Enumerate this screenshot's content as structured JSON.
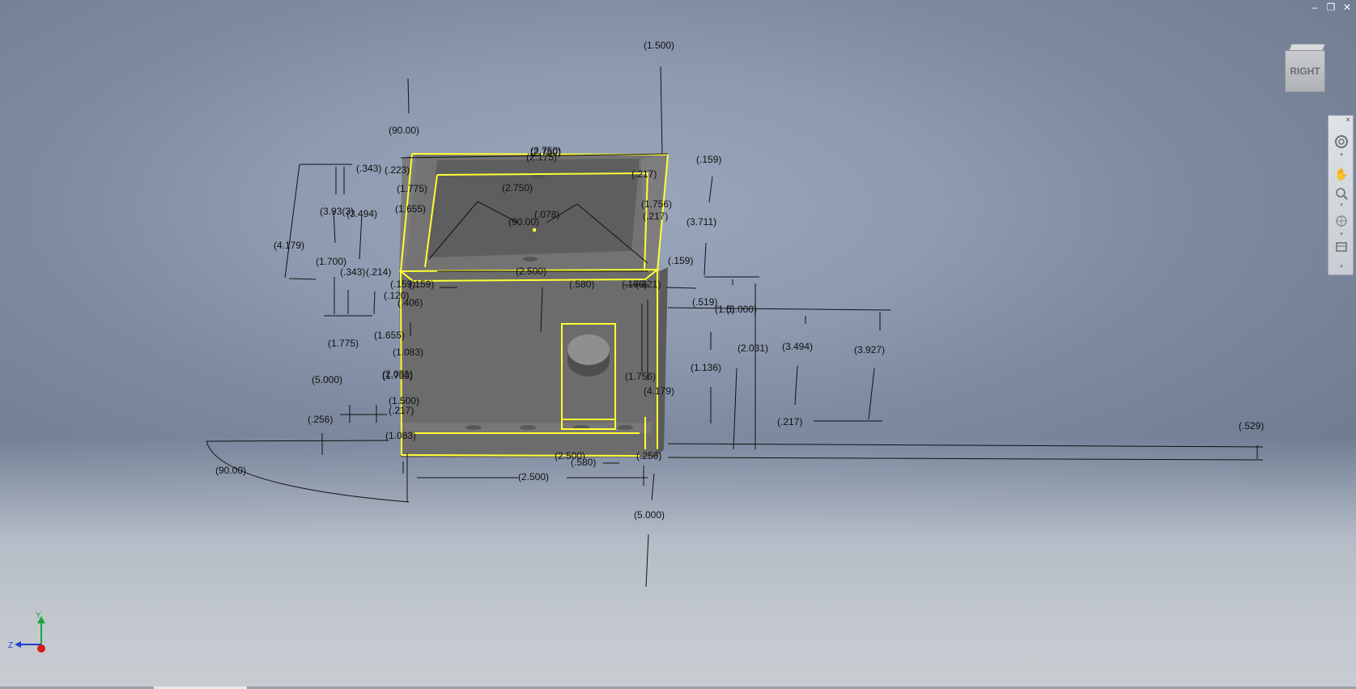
{
  "window": {
    "minimize_glyph": "–",
    "restore_glyph": "❐",
    "close_glyph": "✕"
  },
  "viewcube": {
    "face_label": "RIGHT"
  },
  "navbar": {
    "close_glyph": "×",
    "tools": [
      "steering-wheel-icon",
      "pan-icon",
      "zoom-icon",
      "orbit-icon",
      "look-at-icon"
    ]
  },
  "axis": {
    "y": "Y",
    "z": "Z"
  },
  "colors": {
    "selection": "#ffff33",
    "body": "#6a6a6a",
    "dimension_text": "#111111"
  },
  "dimensions": [
    "(1.500)",
    "(90.00)",
    "(2.750)",
    "(2.750)",
    "(2.175)",
    "(.159)",
    "(.343)",
    "(.223)",
    "(.217)",
    "(1.775)",
    "(2.750)",
    "(3.93(3)",
    "(3.494)",
    "(1.655)",
    "(.078)",
    "(1.756)",
    "(.217)",
    "(90.00)",
    "(3.711)",
    "(4.179)",
    "(1.700)",
    "(.159)",
    "(.343)",
    "(.214)",
    "(2.500)",
    "(.159)",
    "(.159)",
    "(.580)",
    "(.166)",
    "(.121)",
    "(.120)",
    "(.406)",
    "(.519)",
    "(1.5)",
    "(5.000)",
    "(1.655)",
    "(1.775)",
    "(1.083)",
    "(2.031)",
    "(3.494)",
    "(3.927)",
    "(1.136)",
    "(5.000)",
    "(2.031)",
    "(1.750)",
    "(1.500)",
    "(1.756)",
    "(4.179)",
    "(.217)",
    "(.256)",
    "(1.083)",
    "(.217)",
    "(.529)",
    "(90.00)",
    "(2.500)",
    "(.580)",
    "(.256)",
    "(2.500)",
    "(5.000)"
  ]
}
